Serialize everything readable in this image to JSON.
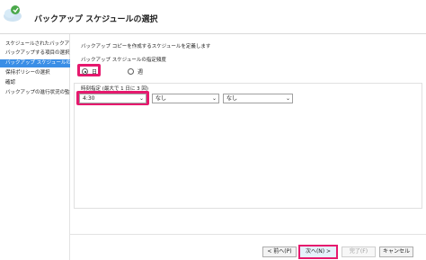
{
  "header": {
    "title": "バックアップ スケジュールの選択",
    "icon": "backup-schedule-icon"
  },
  "sidebar": {
    "items": [
      {
        "label": "スケジュールされたバックアップ...",
        "active": false
      },
      {
        "label": "バックアップする項目の選択",
        "active": false
      },
      {
        "label": "バックアップ スケジュールの選択",
        "active": true
      },
      {
        "label": "保持ポリシーの選択",
        "active": false
      },
      {
        "label": "確認",
        "active": false
      },
      {
        "label": "バックアップの進行状況の監視",
        "active": false
      }
    ]
  },
  "main": {
    "description": "バックアップ コピーを作成するスケジュールを定義します",
    "frequency_label": "バックアップ スケジュールの指定頻度",
    "radio_day": "日",
    "radio_week": "週",
    "time_label": "時刻指定 (最大で 1 日に 3 回)",
    "time1": "4:30",
    "time2": "なし",
    "time3": "なし"
  },
  "footer": {
    "back": "< 前へ(P)",
    "next": "次へ(N) >",
    "finish": "完了(F)",
    "cancel": "キャンセル"
  },
  "colors": {
    "accent": "#3a8ee6",
    "highlight": "#e6196e"
  }
}
